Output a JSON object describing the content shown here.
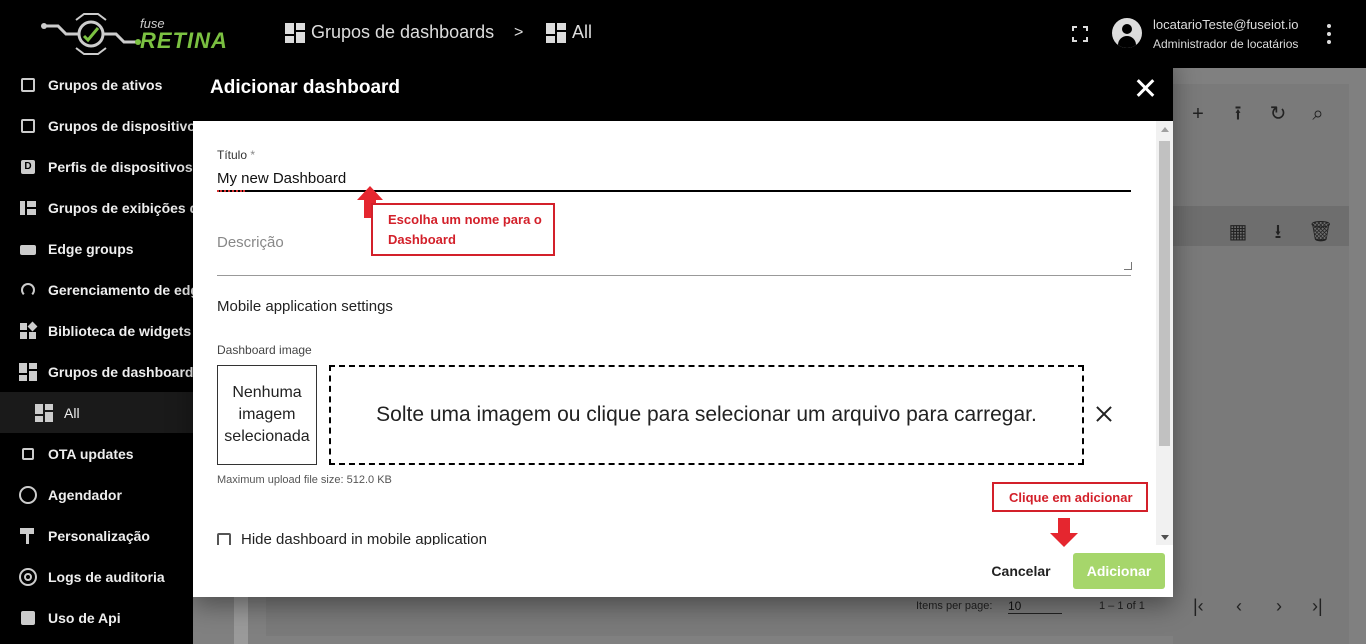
{
  "header": {
    "logo_small": "fuse",
    "logo_big": "RETINA",
    "breadcrumb": [
      {
        "label": "Grupos de dashboards"
      },
      {
        "label": "All"
      }
    ],
    "breadcrumb_separator": ">",
    "user_email": "locatarioTeste@fuseiot.io",
    "user_role": "Administrador de locatários"
  },
  "sidebar": {
    "items": [
      {
        "label": "Grupos de ativos",
        "icon": "building-icon"
      },
      {
        "label": "Grupos de dispositivos",
        "icon": "devices-icon"
      },
      {
        "label": "Perfis de dispositivos",
        "icon": "device-profile-icon",
        "letter": "D"
      },
      {
        "label": "Grupos de exibições de entidades",
        "icon": "entity-view-icon"
      },
      {
        "label": "Edge groups",
        "icon": "edge-icon"
      },
      {
        "label": "Gerenciamento de edge",
        "icon": "antenna-icon"
      },
      {
        "label": "Biblioteca de widgets",
        "icon": "widgets-icon"
      },
      {
        "label": "Grupos de dashboards",
        "icon": "dashboard-icon"
      },
      {
        "label": "All",
        "icon": "dashboard-icon",
        "sub": true
      },
      {
        "label": "OTA updates",
        "icon": "chip-icon"
      },
      {
        "label": "Agendador",
        "icon": "clock-icon"
      },
      {
        "label": "Personalização",
        "icon": "paint-roller-icon"
      },
      {
        "label": "Logs de auditoria",
        "icon": "track-changes-icon"
      },
      {
        "label": "Uso de Api",
        "icon": "chart-icon"
      }
    ]
  },
  "background": {
    "items_per_page_label": "Items per page:",
    "items_per_page_value": "10",
    "range_label": "1 – 1 of 1"
  },
  "dialog": {
    "title": "Adicionar dashboard",
    "title_field_label": "Título",
    "title_field_required": "*",
    "title_field_value": "My new Dashboard",
    "description_placeholder": "Descrição",
    "mobile_settings_label": "Mobile application settings",
    "dashboard_image_label": "Dashboard image",
    "no_image_text": "Nenhuma imagem selecionada",
    "dropzone_text": "Solte uma imagem ou clique para selecionar um arquivo para carregar.",
    "max_upload_text": "Maximum upload file size: 512.0 KB",
    "hide_checkbox_label": "Hide dashboard in mobile application",
    "cancel_label": "Cancelar",
    "add_label": "Adicionar"
  },
  "annotations": {
    "name_hint": "Escolha um nome para o Dashboard",
    "add_hint": "Clique em adicionar",
    "color": "#d3202a"
  },
  "colors": {
    "topbar": "#000000",
    "accent_green": "#7cc242",
    "add_button": "#a6d66b"
  }
}
